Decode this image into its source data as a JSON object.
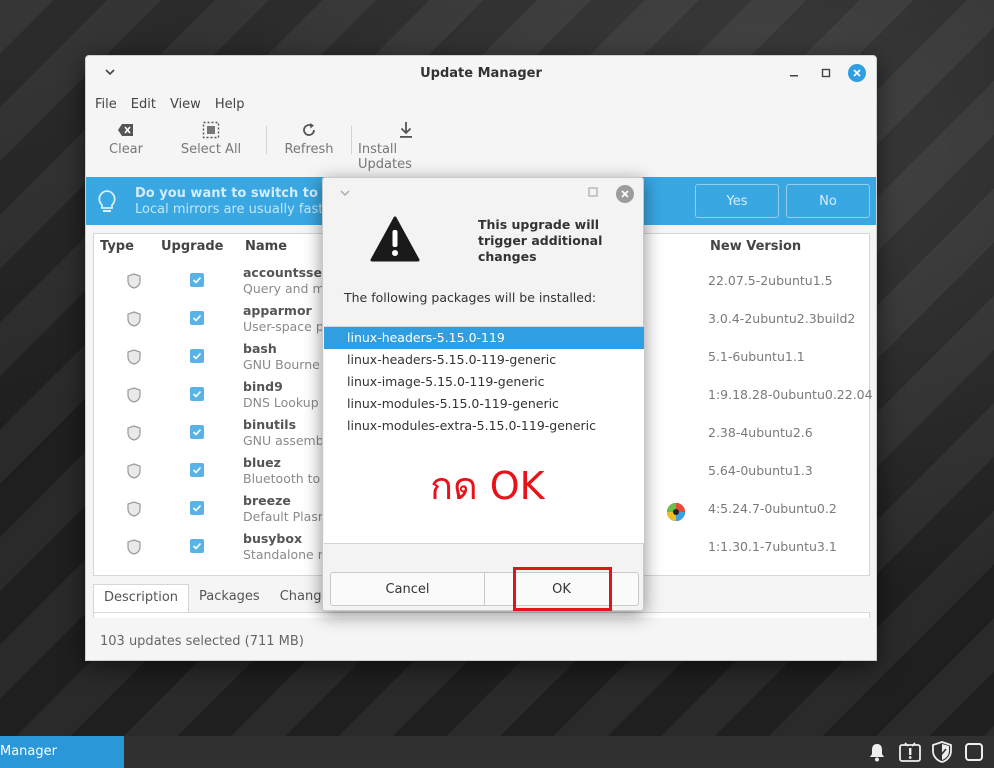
{
  "window": {
    "title": "Update Manager"
  },
  "menu": [
    "File",
    "Edit",
    "View",
    "Help"
  ],
  "toolbar": {
    "clear": "Clear",
    "select_all": "Select All",
    "refresh": "Refresh",
    "install_updates": "Install Updates"
  },
  "infobar": {
    "line1": "Do you want to switch to a loc",
    "line2": "Local mirrors are usually faster",
    "yes": "Yes",
    "no": "No"
  },
  "columns": {
    "type": "Type",
    "upgrade": "Upgrade",
    "name": "Name",
    "new_version": "New Version"
  },
  "packages": [
    {
      "name": "accountsserv",
      "desc": "Query and ma",
      "version": "22.07.5-2ubuntu1.5"
    },
    {
      "name": "apparmor",
      "desc": "User-space pa",
      "version": "3.0.4-2ubuntu2.3build2"
    },
    {
      "name": "bash",
      "desc": "GNU Bourne",
      "version": "5.1-6ubuntu1.1"
    },
    {
      "name": "bind9",
      "desc": "DNS Lookup",
      "version": "1:9.18.28-0ubuntu0.22.04"
    },
    {
      "name": "binutils",
      "desc": "GNU assembl",
      "version": "2.38-4ubuntu2.6"
    },
    {
      "name": "bluez",
      "desc": "Bluetooth to",
      "version": "5.64-0ubuntu1.3"
    },
    {
      "name": "breeze",
      "desc": "Default Plasm",
      "version": "4:5.24.7-0ubuntu0.2"
    },
    {
      "name": "busybox",
      "desc": "Standalone re",
      "version": "1:1.30.1-7ubuntu3.1"
    }
  ],
  "tabs": [
    "Description",
    "Packages",
    "Changel"
  ],
  "status": "103 updates selected (711 MB)",
  "dialog": {
    "title": "This upgrade will trigger additional changes",
    "subtitle": "The following packages will be installed:",
    "packages": [
      "linux-headers-5.15.0-119",
      "linux-headers-5.15.0-119-generic",
      "linux-image-5.15.0-119-generic",
      "linux-modules-5.15.0-119-generic",
      "linux-modules-extra-5.15.0-119-generic"
    ],
    "annotation": "กด OK",
    "cancel": "Cancel",
    "ok": "OK"
  },
  "taskbar": {
    "active_item": "Manager"
  },
  "colors": {
    "accent": "#2f9fe1",
    "infobar": "#39a7e2",
    "annotation": "#e0141b"
  }
}
